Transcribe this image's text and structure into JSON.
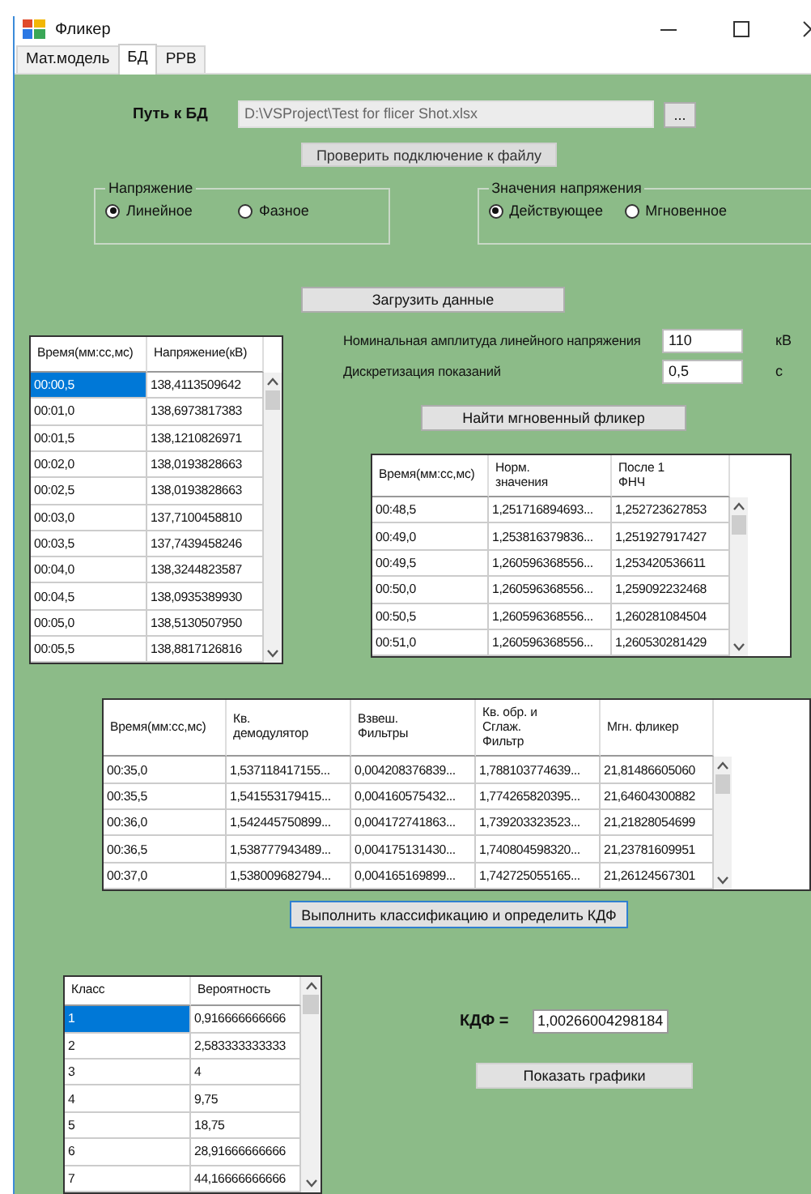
{
  "window": {
    "title": "Фликер"
  },
  "tabs": [
    {
      "label": "Мат.модель",
      "selected": false
    },
    {
      "label": "БД",
      "selected": true
    },
    {
      "label": "РРВ",
      "selected": false
    }
  ],
  "db_path": {
    "label": "Путь к БД",
    "value": "D:\\VSProject\\Test for flicer Shot.xlsx",
    "disabled": true,
    "browse_button": "..."
  },
  "check_button": "Проверить подключение к файлу",
  "voltage_group": {
    "title": "Напряжение",
    "options": [
      {
        "label": "Линейное",
        "selected": true
      },
      {
        "label": "Фазное",
        "selected": false
      }
    ]
  },
  "value_group": {
    "title": "Значения напряжения",
    "options": [
      {
        "label": "Действующее",
        "selected": true
      },
      {
        "label": "Мгновенное",
        "selected": false
      }
    ]
  },
  "load_button": "Загрузить данные",
  "db_table": {
    "columns": [
      "Время(мм:сс,мс)",
      "Напряжение(кВ)"
    ],
    "rows": [
      {
        "cells": [
          "00:00,5",
          "138,4113509642"
        ],
        "selected": true
      },
      {
        "cells": [
          "00:01,0",
          "138,6973817383"
        ],
        "selected": false
      },
      {
        "cells": [
          "00:01,5",
          "138,1210826971"
        ],
        "selected": false
      },
      {
        "cells": [
          "00:02,0",
          "138,0193828663"
        ],
        "selected": false
      },
      {
        "cells": [
          "00:02,5",
          "138,0193828663"
        ],
        "selected": false
      },
      {
        "cells": [
          "00:03,0",
          "137,7100458810"
        ],
        "selected": false
      },
      {
        "cells": [
          "00:03,5",
          "137,7439458246"
        ],
        "selected": false
      },
      {
        "cells": [
          "00:04,0",
          "138,3244823587"
        ],
        "selected": false
      },
      {
        "cells": [
          "00:04,5",
          "138,0935389930"
        ],
        "selected": false
      },
      {
        "cells": [
          "00:05,0",
          "138,5130507950"
        ],
        "selected": false
      },
      {
        "cells": [
          "00:05,5",
          "138,8817126816"
        ],
        "selected": false
      }
    ]
  },
  "nominal": {
    "label": "Номинальная амплитуда линейного напряжения",
    "value": "110",
    "unit": "кВ"
  },
  "sampling": {
    "label": "Дискретизация показаний",
    "value": "0,5",
    "unit": "с"
  },
  "find_button": "Найти мгновенный фликер",
  "flicker_table": {
    "columns": [
      "Время(мм:сс,мс)",
      "Норм.\nзначения",
      "После 1\nФНЧ"
    ],
    "rows": [
      {
        "cells": [
          "00:48,5",
          "1,251716894693...",
          "1,252723627853"
        ]
      },
      {
        "cells": [
          "00:49,0",
          "1,253816379836...",
          "1,251927917427"
        ]
      },
      {
        "cells": [
          "00:49,5",
          "1,260596368556...",
          "1,253420536611"
        ]
      },
      {
        "cells": [
          "00:50,0",
          "1,260596368556...",
          "1,259092232468"
        ]
      },
      {
        "cells": [
          "00:50,5",
          "1,260596368556...",
          "1,260281084504"
        ]
      },
      {
        "cells": [
          "00:51,0",
          "1,260596368556...",
          "1,260530281429"
        ]
      }
    ]
  },
  "processing_table": {
    "columns": [
      "Время(мм:сс,мс)",
      "Кв.\nдемодулятор",
      "Взвеш.\nФильтры",
      "Кв. обр. и\nСглаж.\nФильтр",
      "Мгн. фликер"
    ],
    "rows": [
      {
        "cells": [
          "00:35,0",
          "1,537118417155...",
          "0,004208376839...",
          "1,788103774639...",
          "21,81486605060"
        ]
      },
      {
        "cells": [
          "00:35,5",
          "1,541553179415...",
          "0,004160575432...",
          "1,774265820395...",
          "21,64604300882"
        ]
      },
      {
        "cells": [
          "00:36,0",
          "1,542445750899...",
          "0,004172741863...",
          "1,739203323523...",
          "21,21828054699"
        ]
      },
      {
        "cells": [
          "00:36,5",
          "1,538777943489...",
          "0,004175131430...",
          "1,740804598320...",
          "21,23781609951"
        ]
      },
      {
        "cells": [
          "00:37,0",
          "1,538009682794...",
          "0,004165169899...",
          "1,742725055165...",
          "21,26124567301"
        ]
      }
    ]
  },
  "classify_button": "Выполнить классификацию и определить КДФ",
  "class_table": {
    "columns": [
      "Класс",
      "Вероятность"
    ],
    "rows": [
      {
        "cells": [
          "1",
          "0,916666666666"
        ],
        "selected": true
      },
      {
        "cells": [
          "2",
          "2,583333333333"
        ],
        "selected": false
      },
      {
        "cells": [
          "3",
          "4"
        ],
        "selected": false
      },
      {
        "cells": [
          "4",
          "9,75"
        ],
        "selected": false
      },
      {
        "cells": [
          "5",
          "18,75"
        ],
        "selected": false
      },
      {
        "cells": [
          "6",
          "28,91666666666"
        ],
        "selected": false
      },
      {
        "cells": [
          "7",
          "44,16666666666"
        ],
        "selected": false
      }
    ]
  },
  "kdf": {
    "label": "КДФ =",
    "value": "1,00266004298184"
  },
  "graphs_button": "Показать графики"
}
